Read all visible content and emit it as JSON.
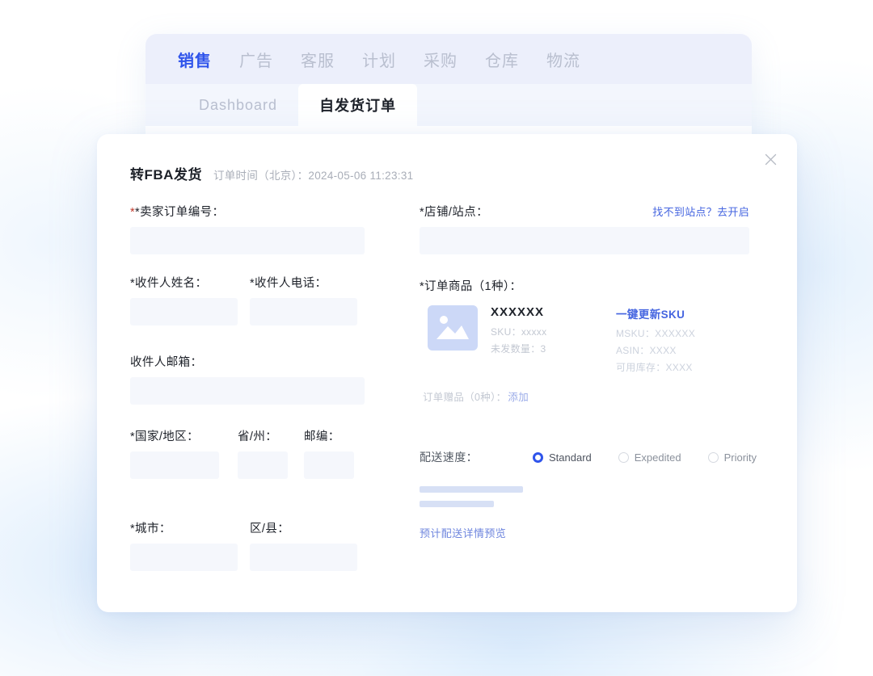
{
  "app": {
    "nav_tabs": [
      {
        "label": "销售",
        "active": true
      },
      {
        "label": "广告",
        "active": false
      },
      {
        "label": "客服",
        "active": false
      },
      {
        "label": "计划",
        "active": false
      },
      {
        "label": "采购",
        "active": false
      },
      {
        "label": "仓库",
        "active": false
      },
      {
        "label": "物流",
        "active": false
      }
    ],
    "sub_tabs": [
      {
        "label": "Dashboard",
        "active": false
      },
      {
        "label": "自发货订单",
        "active": true
      }
    ]
  },
  "modal": {
    "title": "转FBA发货",
    "subtitle": "订单时间（北京）：2024-05-06 11:23:31",
    "close_icon": "close-icon",
    "left": {
      "seller_order_no_label": "*卖家订单编号：",
      "seller_order_no_value": "",
      "recipient_name_label": "*收件人姓名：",
      "recipient_name_value": "",
      "recipient_phone_label": "*收件人电话：",
      "recipient_phone_value": "",
      "recipient_email_label": "收件人邮箱：",
      "recipient_email_value": "",
      "country_label": "*国家/地区：",
      "country_value": "",
      "province_label": "省/州：",
      "province_value": "",
      "postcode_label": "邮编：",
      "postcode_value": "",
      "city_label": "*城市：",
      "city_value": "",
      "district_label": "区/县：",
      "district_value": ""
    },
    "right": {
      "store_site_label": "*店铺/站点：",
      "store_site_value": "",
      "store_site_link": "找不到站点？去开启",
      "order_items_label": "*订单商品（1种）：",
      "product": {
        "thumb_icon": "image-placeholder-icon",
        "name": "XXXXXX",
        "sku": "SKU：xxxxx",
        "unshipped_qty": "未发数量：3",
        "update_sku_link": "一键更新SKU",
        "msku": "MSKU：XXXXXX",
        "asin": "ASIN：XXXX",
        "available_stock": "可用库存：XXXX"
      },
      "gift_label": "订单赠品（0种）：",
      "gift_add_link": "添加",
      "shipping_speed_label": "配送速度：",
      "shipping_speed_options": [
        {
          "label": "Standard",
          "selected": true
        },
        {
          "label": "Expedited",
          "selected": false
        },
        {
          "label": "Priority",
          "selected": false
        }
      ],
      "delivery_preview_link": "预计配送详情预览"
    }
  },
  "colors": {
    "accent": "#2f54eb",
    "link": "#4565e0",
    "required": "#c0392b",
    "skeleton": "#f5f7fc",
    "bar": "#d7e0f5"
  }
}
